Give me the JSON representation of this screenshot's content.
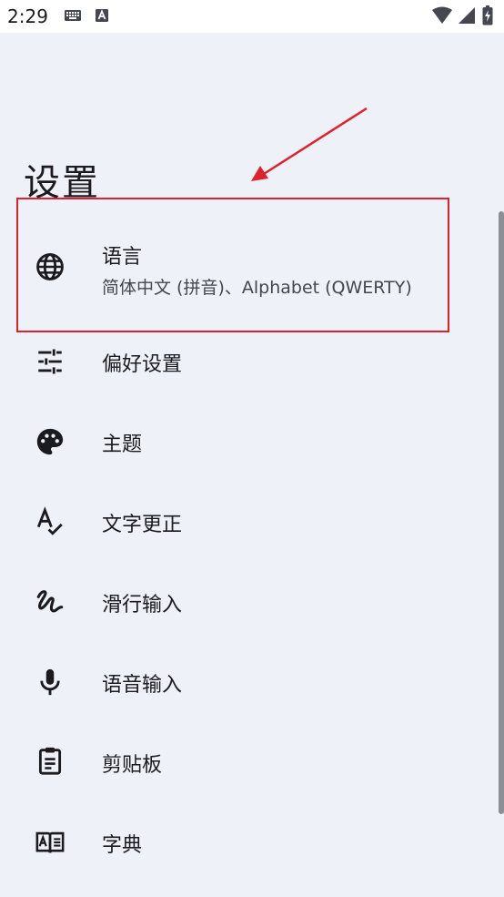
{
  "status_bar": {
    "time": "2:29",
    "icons": [
      "keyboard-icon",
      "a-icon",
      "wifi-icon",
      "signal-icon",
      "battery-icon"
    ]
  },
  "page": {
    "title": "设置"
  },
  "settings_items": [
    {
      "icon": "globe-icon",
      "title": "语言",
      "summary": "简体中文 (拼音)、Alphabet (QWERTY)"
    },
    {
      "icon": "tune-sliders-icon",
      "title": "偏好设置"
    },
    {
      "icon": "palette-icon",
      "title": "主题"
    },
    {
      "icon": "spellcheck-icon",
      "title": "文字更正"
    },
    {
      "icon": "gesture-icon",
      "title": "滑行输入"
    },
    {
      "icon": "mic-icon",
      "title": "语音输入"
    },
    {
      "icon": "clipboard-icon",
      "title": "剪贴板"
    },
    {
      "icon": "dictionary-icon",
      "title": "字典"
    }
  ],
  "annotation": {
    "color": "#e0202a"
  }
}
